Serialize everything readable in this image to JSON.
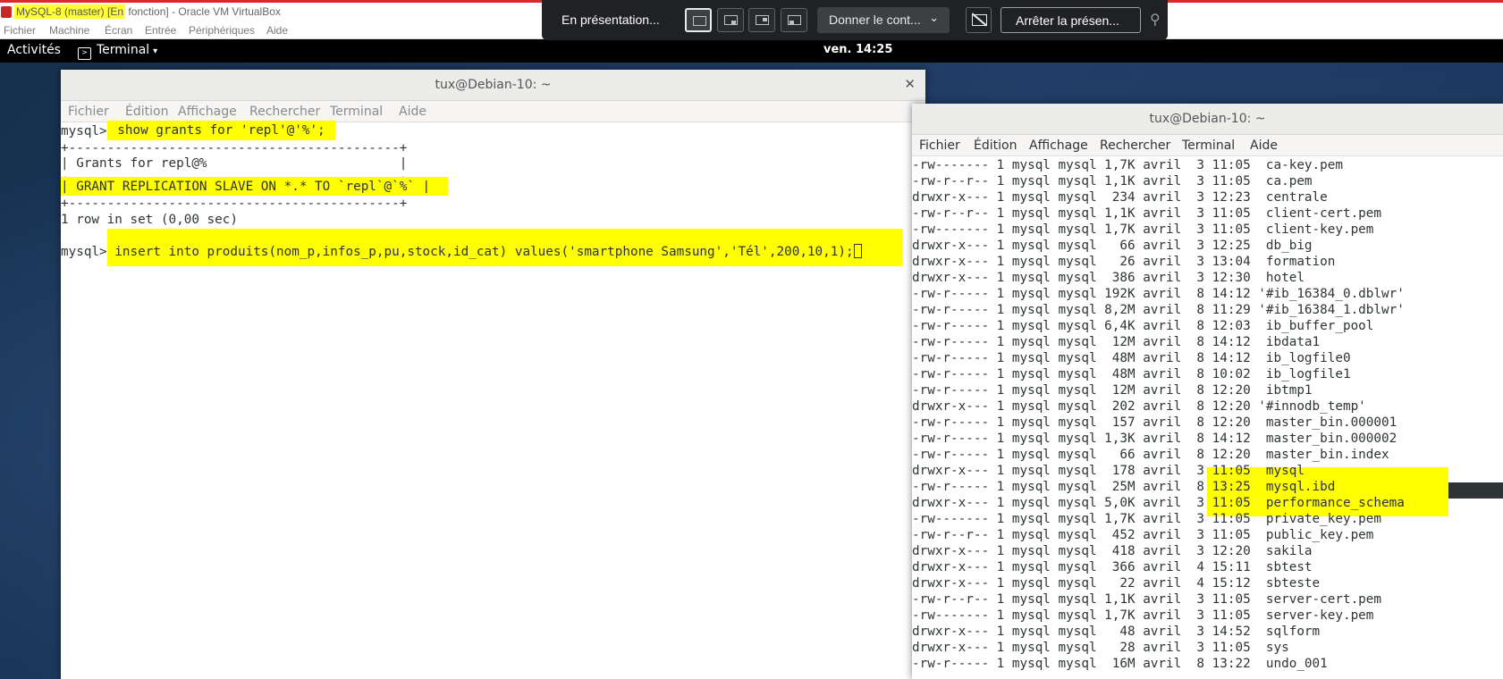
{
  "virtualbox": {
    "title_highlight": "MySQL-8 (master) [En",
    "title_rest": " fonction] - Oracle VM VirtualBox",
    "menu": [
      "Fichier",
      "Machine",
      "Écran",
      "Entrée",
      "Périphériques",
      "Aide"
    ]
  },
  "presentation": {
    "status": "En présentation...",
    "control_label": "Donner le cont...",
    "stop_label": "Arrêter la présen..."
  },
  "gnome": {
    "activities": "Activités",
    "app_name": "Terminal",
    "clock": "ven. 14:25"
  },
  "left_terminal": {
    "title": "tux@Debian-10: ~",
    "menu": [
      "Fichier",
      "Édition",
      "Affichage",
      "Rechercher",
      "Terminal",
      "Aide"
    ],
    "prompt1": "mysql>",
    "command1": " show grants for 'repl'@'%'; ",
    "border": "+-------------------------------------------+",
    "grant_header": "| Grants for repl@%                         |",
    "grant_row": "| GRANT REPLICATION SLAVE ON *.* TO `repl`@`%` |",
    "row_count": "1 row in set (0,00 sec)",
    "prompt2": "mysql>",
    "command2": " insert into produits(nom_p,infos_p,pu,stock,id_cat) values('smartphone Samsung','Tél',200,10,1);"
  },
  "right_terminal": {
    "title": "tux@Debian-10: ~",
    "menu": [
      "Fichier",
      "Édition",
      "Affichage",
      "Rechercher",
      "Terminal",
      "Aide"
    ],
    "listing": [
      {
        "perm": "-rw-------",
        "links": "1",
        "user": "mysql",
        "group": "mysql",
        "size": "1,7K",
        "month": "avril",
        "day": "3",
        "time": "11:05",
        "name": " ca-key.pem"
      },
      {
        "perm": "-rw-r--r--",
        "links": "1",
        "user": "mysql",
        "group": "mysql",
        "size": "1,1K",
        "month": "avril",
        "day": "3",
        "time": "11:05",
        "name": " ca.pem"
      },
      {
        "perm": "drwxr-x---",
        "links": "1",
        "user": "mysql",
        "group": "mysql",
        "size": "234",
        "month": "avril",
        "day": "3",
        "time": "12:23",
        "name": " centrale"
      },
      {
        "perm": "-rw-r--r--",
        "links": "1",
        "user": "mysql",
        "group": "mysql",
        "size": "1,1K",
        "month": "avril",
        "day": "3",
        "time": "11:05",
        "name": " client-cert.pem"
      },
      {
        "perm": "-rw-------",
        "links": "1",
        "user": "mysql",
        "group": "mysql",
        "size": "1,7K",
        "month": "avril",
        "day": "3",
        "time": "11:05",
        "name": " client-key.pem"
      },
      {
        "perm": "drwxr-x---",
        "links": "1",
        "user": "mysql",
        "group": "mysql",
        "size": "66",
        "month": "avril",
        "day": "3",
        "time": "12:25",
        "name": " db_big"
      },
      {
        "perm": "drwxr-x---",
        "links": "1",
        "user": "mysql",
        "group": "mysql",
        "size": "26",
        "month": "avril",
        "day": "3",
        "time": "13:04",
        "name": " formation"
      },
      {
        "perm": "drwxr-x---",
        "links": "1",
        "user": "mysql",
        "group": "mysql",
        "size": "386",
        "month": "avril",
        "day": "3",
        "time": "12:30",
        "name": " hotel"
      },
      {
        "perm": "-rw-r-----",
        "links": "1",
        "user": "mysql",
        "group": "mysql",
        "size": "192K",
        "month": "avril",
        "day": "8",
        "time": "14:12",
        "name": "'#ib_16384_0.dblwr'"
      },
      {
        "perm": "-rw-r-----",
        "links": "1",
        "user": "mysql",
        "group": "mysql",
        "size": "8,2M",
        "month": "avril",
        "day": "8",
        "time": "11:29",
        "name": "'#ib_16384_1.dblwr'"
      },
      {
        "perm": "-rw-r-----",
        "links": "1",
        "user": "mysql",
        "group": "mysql",
        "size": "6,4K",
        "month": "avril",
        "day": "8",
        "time": "12:03",
        "name": " ib_buffer_pool"
      },
      {
        "perm": "-rw-r-----",
        "links": "1",
        "user": "mysql",
        "group": "mysql",
        "size": "12M",
        "month": "avril",
        "day": "8",
        "time": "14:12",
        "name": " ibdata1"
      },
      {
        "perm": "-rw-r-----",
        "links": "1",
        "user": "mysql",
        "group": "mysql",
        "size": "48M",
        "month": "avril",
        "day": "8",
        "time": "14:12",
        "name": " ib_logfile0"
      },
      {
        "perm": "-rw-r-----",
        "links": "1",
        "user": "mysql",
        "group": "mysql",
        "size": "48M",
        "month": "avril",
        "day": "8",
        "time": "10:02",
        "name": " ib_logfile1"
      },
      {
        "perm": "-rw-r-----",
        "links": "1",
        "user": "mysql",
        "group": "mysql",
        "size": "12M",
        "month": "avril",
        "day": "8",
        "time": "12:20",
        "name": " ibtmp1"
      },
      {
        "perm": "drwxr-x---",
        "links": "1",
        "user": "mysql",
        "group": "mysql",
        "size": "202",
        "month": "avril",
        "day": "8",
        "time": "12:20",
        "name": "'#innodb_temp'"
      },
      {
        "perm": "-rw-r-----",
        "links": "1",
        "user": "mysql",
        "group": "mysql",
        "size": "157",
        "month": "avril",
        "day": "8",
        "time": "12:20",
        "name": " master_bin.000001"
      },
      {
        "perm": "-rw-r-----",
        "links": "1",
        "user": "mysql",
        "group": "mysql",
        "size": "1,3K",
        "month": "avril",
        "day": "8",
        "time": "14:12",
        "name": " master_bin.000002"
      },
      {
        "perm": "-rw-r-----",
        "links": "1",
        "user": "mysql",
        "group": "mysql",
        "size": "66",
        "month": "avril",
        "day": "8",
        "time": "12:20",
        "name": " master_bin.index"
      },
      {
        "perm": "drwxr-x---",
        "links": "1",
        "user": "mysql",
        "group": "mysql",
        "size": "178",
        "month": "avril",
        "day": "3",
        "time": "11:05",
        "name": " mysql"
      },
      {
        "perm": "-rw-r-----",
        "links": "1",
        "user": "mysql",
        "group": "mysql",
        "size": "25M",
        "month": "avril",
        "day": "8",
        "time": "13:25",
        "name": " mysql.ibd"
      },
      {
        "perm": "drwxr-x---",
        "links": "1",
        "user": "mysql",
        "group": "mysql",
        "size": "5,0K",
        "month": "avril",
        "day": "3",
        "time": "11:05",
        "name": " performance_schema"
      },
      {
        "perm": "-rw-------",
        "links": "1",
        "user": "mysql",
        "group": "mysql",
        "size": "1,7K",
        "month": "avril",
        "day": "3",
        "time": "11:05",
        "name": " private_key.pem"
      },
      {
        "perm": "-rw-r--r--",
        "links": "1",
        "user": "mysql",
        "group": "mysql",
        "size": "452",
        "month": "avril",
        "day": "3",
        "time": "11:05",
        "name": " public_key.pem"
      },
      {
        "perm": "drwxr-x---",
        "links": "1",
        "user": "mysql",
        "group": "mysql",
        "size": "418",
        "month": "avril",
        "day": "3",
        "time": "12:20",
        "name": " sakila"
      },
      {
        "perm": "drwxr-x---",
        "links": "1",
        "user": "mysql",
        "group": "mysql",
        "size": "366",
        "month": "avril",
        "day": "4",
        "time": "15:11",
        "name": " sbtest"
      },
      {
        "perm": "drwxr-x---",
        "links": "1",
        "user": "mysql",
        "group": "mysql",
        "size": "22",
        "month": "avril",
        "day": "4",
        "time": "15:12",
        "name": " sbteste"
      },
      {
        "perm": "-rw-r--r--",
        "links": "1",
        "user": "mysql",
        "group": "mysql",
        "size": "1,1K",
        "month": "avril",
        "day": "3",
        "time": "11:05",
        "name": " server-cert.pem"
      },
      {
        "perm": "-rw-------",
        "links": "1",
        "user": "mysql",
        "group": "mysql",
        "size": "1,7K",
        "month": "avril",
        "day": "3",
        "time": "11:05",
        "name": " server-key.pem"
      },
      {
        "perm": "drwxr-x---",
        "links": "1",
        "user": "mysql",
        "group": "mysql",
        "size": "48",
        "month": "avril",
        "day": "3",
        "time": "14:52",
        "name": " sqlform"
      },
      {
        "perm": "drwxr-x---",
        "links": "1",
        "user": "mysql",
        "group": "mysql",
        "size": "28",
        "month": "avril",
        "day": "3",
        "time": "11:05",
        "name": " sys"
      },
      {
        "perm": "-rw-r-----",
        "links": "1",
        "user": "mysql",
        "group": "mysql",
        "size": "16M",
        "month": "avril",
        "day": "8",
        "time": "13:22",
        "name": " undo_001"
      }
    ]
  },
  "colors": {
    "highlight": "#ffff00",
    "terminal_text": "#2e3436",
    "desktop": "#1b3350"
  }
}
